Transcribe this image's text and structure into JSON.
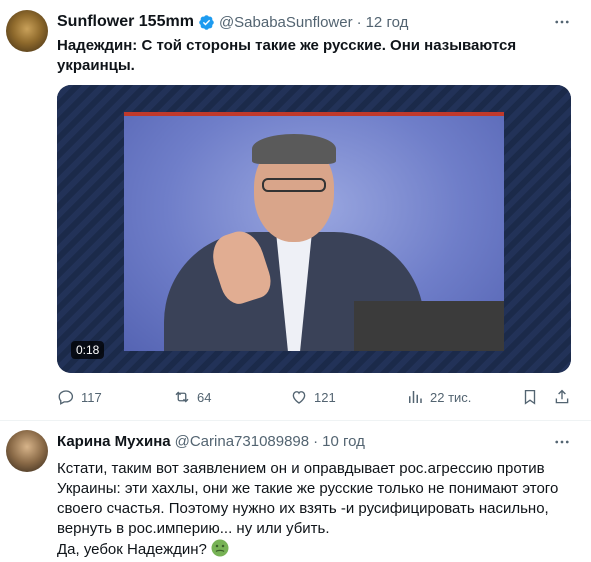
{
  "tweet1": {
    "author_name": "Sunflower 155mm",
    "handle": "@SababaSunflower",
    "separator": "·",
    "time": "12 год",
    "text": "Надеждин: С той стороны такие же русские. Они называются украинцы.",
    "video_duration": "0:18",
    "actions": {
      "replies": "117",
      "reposts": "64",
      "likes": "121",
      "views": "22 тис."
    }
  },
  "tweet2": {
    "author_name": "Карина Мухина",
    "handle": "@Carina731089898",
    "separator": "·",
    "time": "10 год",
    "text_paragraph": "Кстати, таким вот заявлением он и оправдывает рос.агрессию против Украины: эти хахлы, они же такие же русские только не понимают этого своего счастья. Поэтому нужно их взять -и русифицировать насильно, вернуть в рос.империю... ну или убить.",
    "text_last_line": "Да, уебок Надеждин?"
  },
  "colors": {
    "verified_badge": "#1d9bf0",
    "muted_text": "#536471",
    "primary_text": "#0f1419",
    "divider": "#eff3f4"
  },
  "icons": [
    "verified-badge-icon",
    "more-icon",
    "reply-icon",
    "repost-icon",
    "like-icon",
    "views-icon",
    "bookmark-icon",
    "share-icon",
    "nauseated-face-emoji"
  ]
}
